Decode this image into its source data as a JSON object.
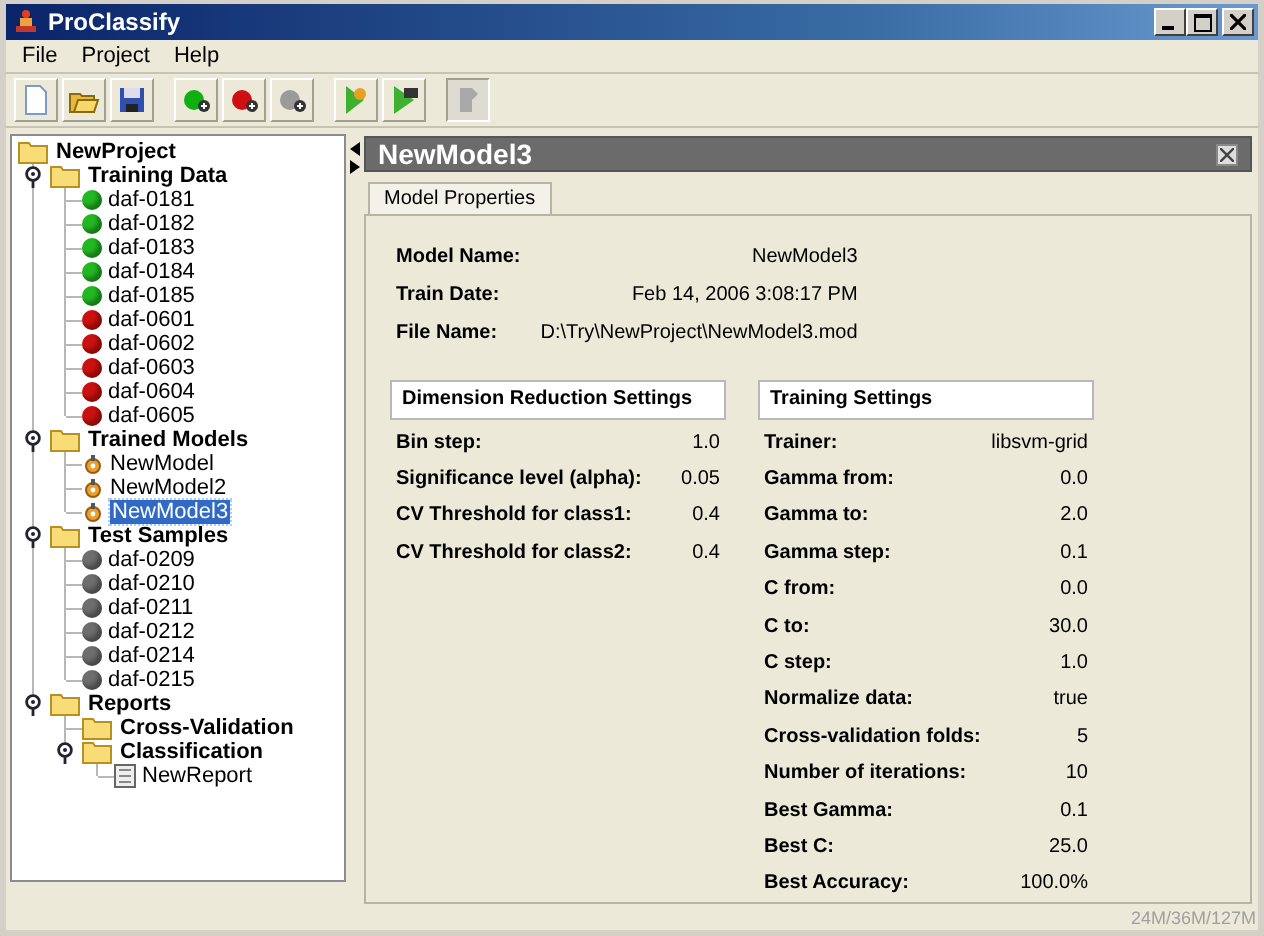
{
  "window": {
    "title": "ProClassify"
  },
  "menu": [
    {
      "label": "File"
    },
    {
      "label": "Project"
    },
    {
      "label": "Help"
    }
  ],
  "toolbar": [
    {
      "kind": "new",
      "disabled": false
    },
    {
      "kind": "open",
      "disabled": false
    },
    {
      "kind": "save",
      "disabled": false
    },
    {
      "kind": "add-class1",
      "disabled": false
    },
    {
      "kind": "add-class2",
      "disabled": false
    },
    {
      "kind": "add-test",
      "disabled": false
    },
    {
      "kind": "train",
      "disabled": false
    },
    {
      "kind": "classify",
      "disabled": false
    },
    {
      "kind": "report",
      "disabled": true
    }
  ],
  "tree": {
    "label": "NewProject",
    "kind": "folder",
    "selected": false,
    "children": [
      {
        "label": "Training Data",
        "kind": "folder",
        "expanded": true,
        "selected": false,
        "children": [
          {
            "label": "daf-0181",
            "kind": "sample",
            "color": "#22b822",
            "selected": false
          },
          {
            "label": "daf-0182",
            "kind": "sample",
            "color": "#22b822",
            "selected": false
          },
          {
            "label": "daf-0183",
            "kind": "sample",
            "color": "#22b822",
            "selected": false
          },
          {
            "label": "daf-0184",
            "kind": "sample",
            "color": "#22b822",
            "selected": false
          },
          {
            "label": "daf-0185",
            "kind": "sample",
            "color": "#22b822",
            "selected": false
          },
          {
            "label": "daf-0601",
            "kind": "sample",
            "color": "#cc1010",
            "selected": false
          },
          {
            "label": "daf-0602",
            "kind": "sample",
            "color": "#cc1010",
            "selected": false
          },
          {
            "label": "daf-0603",
            "kind": "sample",
            "color": "#cc1010",
            "selected": false
          },
          {
            "label": "daf-0604",
            "kind": "sample",
            "color": "#cc1010",
            "selected": false
          },
          {
            "label": "daf-0605",
            "kind": "sample",
            "color": "#cc1010",
            "selected": false
          }
        ]
      },
      {
        "label": "Trained Models",
        "kind": "folder",
        "expanded": true,
        "selected": false,
        "children": [
          {
            "label": "NewModel",
            "kind": "model",
            "selected": false
          },
          {
            "label": "NewModel2",
            "kind": "model",
            "selected": false
          },
          {
            "label": "NewModel3",
            "kind": "model",
            "selected": true
          }
        ]
      },
      {
        "label": "Test Samples",
        "kind": "folder",
        "expanded": true,
        "selected": false,
        "children": [
          {
            "label": "daf-0209",
            "kind": "sample",
            "color": "#6e6e6e",
            "selected": false
          },
          {
            "label": "daf-0210",
            "kind": "sample",
            "color": "#6e6e6e",
            "selected": false
          },
          {
            "label": "daf-0211",
            "kind": "sample",
            "color": "#6e6e6e",
            "selected": false
          },
          {
            "label": "daf-0212",
            "kind": "sample",
            "color": "#6e6e6e",
            "selected": false
          },
          {
            "label": "daf-0214",
            "kind": "sample",
            "color": "#6e6e6e",
            "selected": false
          },
          {
            "label": "daf-0215",
            "kind": "sample",
            "color": "#6e6e6e",
            "selected": false
          }
        ]
      },
      {
        "label": "Reports",
        "kind": "folder",
        "expanded": true,
        "selected": false,
        "children": [
          {
            "label": "Cross-Validation",
            "kind": "folder",
            "selected": false
          },
          {
            "label": "Classification",
            "kind": "folder",
            "expanded": true,
            "selected": false,
            "children": [
              {
                "label": "NewReport",
                "kind": "report",
                "selected": false
              }
            ]
          }
        ]
      }
    ]
  },
  "panel": {
    "title": "NewModel3",
    "tabs": [
      {
        "label": "Model Properties",
        "selected": true
      }
    ],
    "properties": [
      {
        "label": "Model Name:",
        "value": "NewModel3"
      },
      {
        "label": "Train Date:",
        "value": "Feb 14, 2006 3:08:17 PM"
      },
      {
        "label": "File Name:",
        "value": "D:\\Try\\NewProject\\NewModel3.mod"
      }
    ],
    "sections": [
      {
        "title": "Dimension Reduction Settings",
        "rows": [
          {
            "label": "Bin step:",
            "value": "1.0"
          },
          {
            "label": "Significance level (alpha):",
            "value": "0.05"
          },
          {
            "label": "CV Threshold for class1:",
            "value": "0.4"
          },
          {
            "label": "CV Threshold for class2:",
            "value": "0.4"
          }
        ]
      },
      {
        "title": "Training Settings",
        "rows": [
          {
            "label": "Trainer:",
            "value": "libsvm-grid"
          },
          {
            "label": "Gamma from:",
            "value": "0.0"
          },
          {
            "label": "Gamma to:",
            "value": "2.0"
          },
          {
            "label": "Gamma step:",
            "value": "0.1"
          },
          {
            "label": "C from:",
            "value": "0.0"
          },
          {
            "label": "C to:",
            "value": "30.0"
          },
          {
            "label": "C step:",
            "value": "1.0"
          },
          {
            "label": "Normalize data:",
            "value": "true"
          },
          {
            "label": "Cross-validation folds:",
            "value": "5"
          },
          {
            "label": "Number of iterations:",
            "value": "10"
          },
          {
            "label": "Best Gamma:",
            "value": "0.1"
          },
          {
            "label": "Best C:",
            "value": "25.0"
          },
          {
            "label": "Best Accuracy:",
            "value": "100.0%"
          }
        ]
      }
    ]
  },
  "status_bar": {
    "memory": "24M/36M/127M"
  }
}
